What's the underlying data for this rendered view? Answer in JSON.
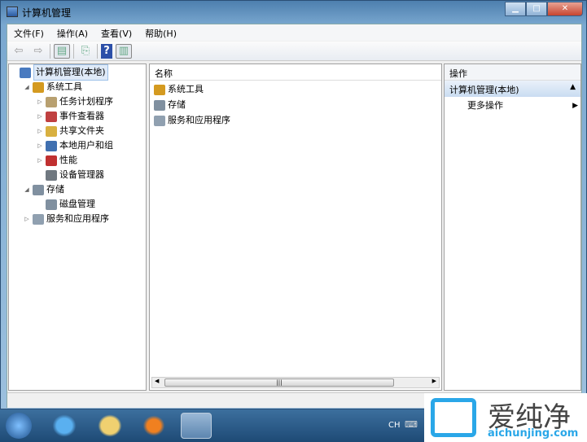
{
  "window": {
    "title": "计算机管理"
  },
  "menu": [
    "文件(F)",
    "操作(A)",
    "查看(V)",
    "帮助(H)"
  ],
  "tree": [
    {
      "label": "计算机管理(本地)",
      "level": 0,
      "expander": "",
      "selected": true,
      "color": "#4a7bc0"
    },
    {
      "label": "系统工具",
      "level": 1,
      "expander": "◢",
      "color": "#d49a20"
    },
    {
      "label": "任务计划程序",
      "level": 2,
      "expander": "▷",
      "color": "#b8a070"
    },
    {
      "label": "事件查看器",
      "level": 2,
      "expander": "▷",
      "color": "#c04040"
    },
    {
      "label": "共享文件夹",
      "level": 2,
      "expander": "▷",
      "color": "#d8b040"
    },
    {
      "label": "本地用户和组",
      "level": 2,
      "expander": "▷",
      "color": "#4070b0"
    },
    {
      "label": "性能",
      "level": 2,
      "expander": "▷",
      "color": "#c03030"
    },
    {
      "label": "设备管理器",
      "level": 2,
      "expander": "",
      "color": "#707880"
    },
    {
      "label": "存储",
      "level": 1,
      "expander": "◢",
      "color": "#8090a0"
    },
    {
      "label": "磁盘管理",
      "level": 2,
      "expander": "",
      "color": "#8090a0"
    },
    {
      "label": "服务和应用程序",
      "level": 1,
      "expander": "▷",
      "color": "#90a0b0"
    }
  ],
  "center": {
    "header": "名称",
    "items": [
      "系统工具",
      "存储",
      "服务和应用程序"
    ]
  },
  "actions": {
    "header": "操作",
    "section": "计算机管理(本地)",
    "items": [
      "更多操作"
    ]
  },
  "taskbar": {
    "lang": "CH"
  },
  "watermark": {
    "text": "爱纯净",
    "url_text": "aichunjing.com"
  }
}
